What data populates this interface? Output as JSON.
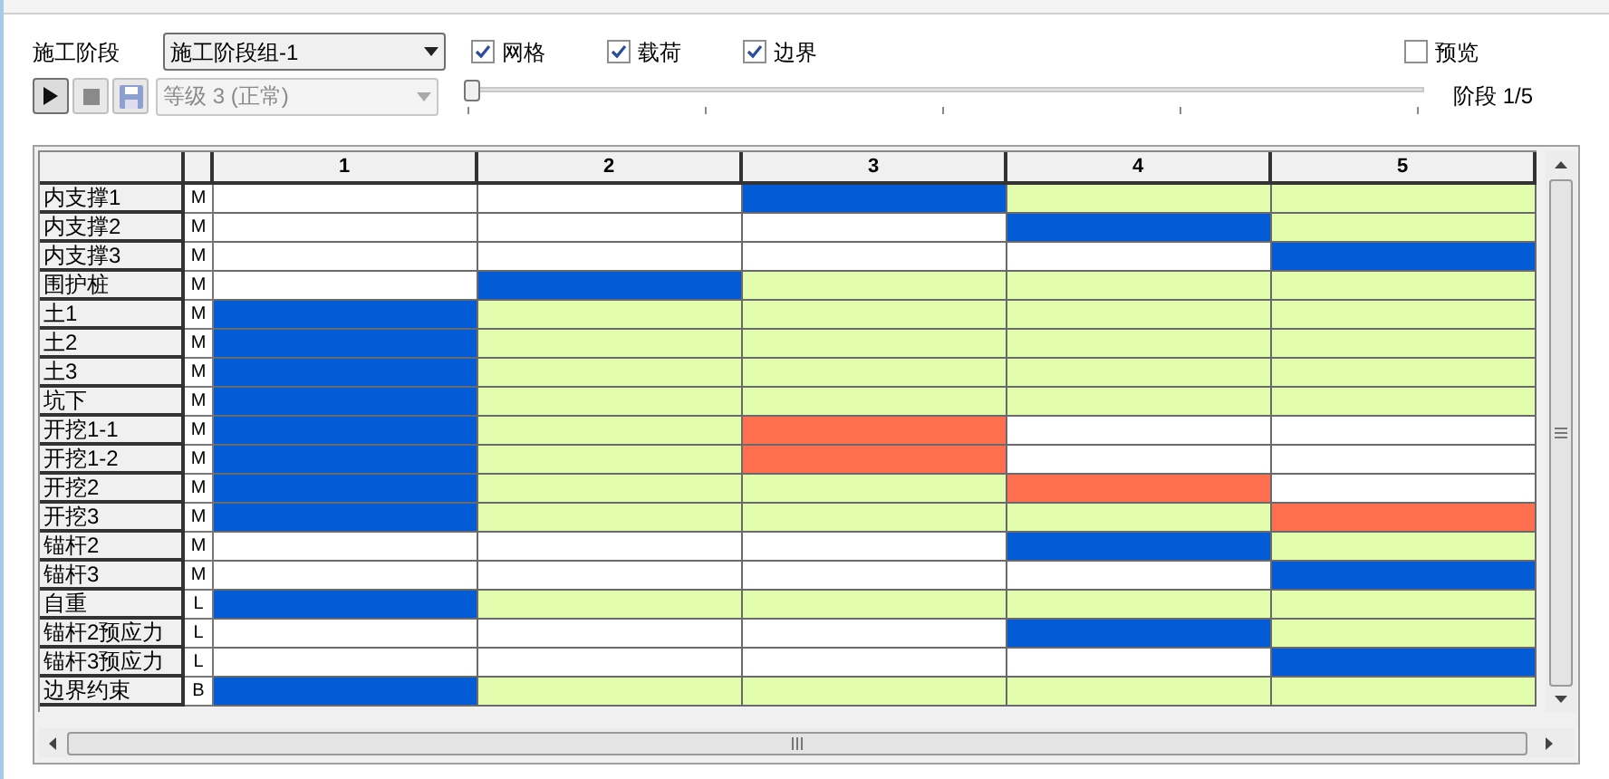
{
  "toolbar": {
    "stage_label": "施工阶段",
    "stage_group": "施工阶段组-1",
    "checkboxes": [
      {
        "label": "网格",
        "checked": true
      },
      {
        "label": "载荷",
        "checked": true
      },
      {
        "label": "边界",
        "checked": true
      }
    ],
    "preview": {
      "label": "预览",
      "checked": false
    },
    "buttons": [
      {
        "kind": "play",
        "disabled": false
      },
      {
        "kind": "stop",
        "disabled": true
      },
      {
        "kind": "save",
        "disabled": true
      }
    ],
    "level_select": {
      "value": "等级 3 (正常)",
      "disabled": true
    },
    "stage_slider": {
      "level": 0
    },
    "stage_reading": "阶段 1/5"
  },
  "table": {
    "columns": [
      "1",
      "2",
      "3",
      "4",
      "5"
    ],
    "rows": [
      {
        "name": "内支撑1",
        "type": "M",
        "cells": [
          {
            "kind": "none"
          },
          {
            "kind": "none"
          },
          {
            "kind": "activate"
          },
          {
            "kind": "exist"
          },
          {
            "kind": "exist"
          }
        ]
      },
      {
        "name": "内支撑2",
        "type": "M",
        "cells": [
          {
            "kind": "none"
          },
          {
            "kind": "none"
          },
          {
            "kind": "none"
          },
          {
            "kind": "activate"
          },
          {
            "kind": "exist"
          }
        ]
      },
      {
        "name": "内支撑3",
        "type": "M",
        "cells": [
          {
            "kind": "none"
          },
          {
            "kind": "none"
          },
          {
            "kind": "none"
          },
          {
            "kind": "none"
          },
          {
            "kind": "activate"
          }
        ]
      },
      {
        "name": "围护桩",
        "type": "M",
        "cells": [
          {
            "kind": "none"
          },
          {
            "kind": "activate"
          },
          {
            "kind": "exist"
          },
          {
            "kind": "exist"
          },
          {
            "kind": "exist"
          }
        ]
      },
      {
        "name": "土1",
        "type": "M",
        "cells": [
          {
            "kind": "activate"
          },
          {
            "kind": "exist"
          },
          {
            "kind": "exist"
          },
          {
            "kind": "exist"
          },
          {
            "kind": "exist"
          }
        ]
      },
      {
        "name": "土2",
        "type": "M",
        "cells": [
          {
            "kind": "activate"
          },
          {
            "kind": "exist"
          },
          {
            "kind": "exist"
          },
          {
            "kind": "exist"
          },
          {
            "kind": "exist"
          }
        ]
      },
      {
        "name": "土3",
        "type": "M",
        "cells": [
          {
            "kind": "activate"
          },
          {
            "kind": "exist"
          },
          {
            "kind": "exist"
          },
          {
            "kind": "exist"
          },
          {
            "kind": "exist"
          }
        ]
      },
      {
        "name": "坑下",
        "type": "M",
        "cells": [
          {
            "kind": "activate"
          },
          {
            "kind": "exist"
          },
          {
            "kind": "exist"
          },
          {
            "kind": "exist"
          },
          {
            "kind": "exist"
          }
        ]
      },
      {
        "name": "开挖1-1",
        "type": "M",
        "cells": [
          {
            "kind": "activate"
          },
          {
            "kind": "exist"
          },
          {
            "kind": "remove"
          },
          {
            "kind": "none"
          },
          {
            "kind": "none"
          }
        ]
      },
      {
        "name": "开挖1-2",
        "type": "M",
        "cells": [
          {
            "kind": "activate"
          },
          {
            "kind": "exist"
          },
          {
            "kind": "remove"
          },
          {
            "kind": "none"
          },
          {
            "kind": "none"
          }
        ]
      },
      {
        "name": "开挖2",
        "type": "M",
        "cells": [
          {
            "kind": "activate"
          },
          {
            "kind": "exist"
          },
          {
            "kind": "exist"
          },
          {
            "kind": "remove"
          },
          {
            "kind": "none"
          }
        ]
      },
      {
        "name": "开挖3",
        "type": "M",
        "cells": [
          {
            "kind": "activate"
          },
          {
            "kind": "exist"
          },
          {
            "kind": "exist"
          },
          {
            "kind": "exist"
          },
          {
            "kind": "remove"
          }
        ]
      },
      {
        "name": "锚杆2",
        "type": "M",
        "cells": [
          {
            "kind": "none"
          },
          {
            "kind": "none"
          },
          {
            "kind": "none"
          },
          {
            "kind": "activate"
          },
          {
            "kind": "exist"
          }
        ]
      },
      {
        "name": "锚杆3",
        "type": "M",
        "cells": [
          {
            "kind": "none"
          },
          {
            "kind": "none"
          },
          {
            "kind": "none"
          },
          {
            "kind": "none"
          },
          {
            "kind": "activate"
          }
        ]
      },
      {
        "name": "自重",
        "type": "L",
        "cells": [
          {
            "kind": "activate"
          },
          {
            "kind": "exist"
          },
          {
            "kind": "exist"
          },
          {
            "kind": "exist"
          },
          {
            "kind": "exist"
          }
        ]
      },
      {
        "name": "锚杆2预应力",
        "type": "L",
        "cells": [
          {
            "kind": "none"
          },
          {
            "kind": "none"
          },
          {
            "kind": "none"
          },
          {
            "kind": "activate"
          },
          {
            "kind": "exist"
          }
        ]
      },
      {
        "name": "锚杆3预应力",
        "type": "L",
        "cells": [
          {
            "kind": "none"
          },
          {
            "kind": "none"
          },
          {
            "kind": "none"
          },
          {
            "kind": "none"
          },
          {
            "kind": "activate"
          }
        ]
      },
      {
        "name": "边界约束",
        "type": "B",
        "cells": [
          {
            "kind": "activate"
          },
          {
            "kind": "exist"
          },
          {
            "kind": "exist"
          },
          {
            "kind": "exist"
          },
          {
            "kind": "exist"
          }
        ]
      }
    ]
  }
}
